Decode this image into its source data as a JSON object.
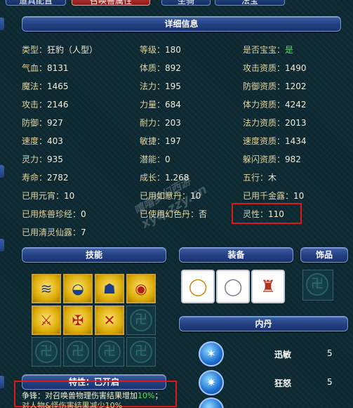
{
  "tabs": [
    "道具配置",
    "召唤兽属性",
    "坐骑",
    "法宝"
  ],
  "detail": {
    "title": "详细信息",
    "col1": [
      {
        "label": "类型：",
        "value": "狂豹（人型）"
      },
      {
        "label": "气血：",
        "value": "8131"
      },
      {
        "label": "魔法：",
        "value": "1465"
      },
      {
        "label": "攻击：",
        "value": "2146"
      },
      {
        "label": "防御：",
        "value": "927"
      },
      {
        "label": "速度：",
        "value": "403"
      },
      {
        "label": "灵力：",
        "value": "935"
      },
      {
        "label": "寿命：",
        "value": "2782"
      },
      {
        "label": "已用元宵：",
        "value": "10"
      },
      {
        "label": "已用炼兽珍经：",
        "value": "0"
      },
      {
        "label": "已用清灵仙露：",
        "value": "7"
      }
    ],
    "col2": [
      {
        "label": "等级：",
        "value": "180"
      },
      {
        "label": "体质：",
        "value": "892"
      },
      {
        "label": "法力：",
        "value": "195"
      },
      {
        "label": "力量：",
        "value": "684"
      },
      {
        "label": "耐力：",
        "value": "203"
      },
      {
        "label": "敏捷：",
        "value": "197"
      },
      {
        "label": "潜能：",
        "value": "0"
      },
      {
        "label": "成长：",
        "value": "1.268"
      },
      {
        "label": "已用如意丹：",
        "value": "10"
      },
      {
        "label": "已使用幻色丹：",
        "value": "否"
      }
    ],
    "col3": [
      {
        "label": "是否宝宝：",
        "value": "是"
      },
      {
        "label": "攻击资质：",
        "value": "1490"
      },
      {
        "label": "防御资质：",
        "value": "1202"
      },
      {
        "label": "体力资质：",
        "value": "4242"
      },
      {
        "label": "法力资质：",
        "value": "2013"
      },
      {
        "label": "速度资质：",
        "value": "1434"
      },
      {
        "label": "躲闪资质：",
        "value": "982"
      },
      {
        "label": "五行：",
        "value": "木"
      },
      {
        "label": "已用千金露：",
        "value": "10"
      },
      {
        "label": "灵性：",
        "value": "110"
      }
    ]
  },
  "sections": {
    "skills": "技能",
    "equipment": "装备",
    "accessory": "饰品",
    "neidan": "内丹",
    "trait": "特性：已开启"
  },
  "neidan": [
    {
      "name": "迅敏",
      "level": "5"
    },
    {
      "name": "狂怒",
      "level": "5"
    }
  ],
  "trait_desc": {
    "line1_prefix": "争锋：对召唤兽物理伤害结果增加",
    "line1_value": "10%",
    "line1_suffix": "；",
    "line2": "对人物&怪伤害结果减少10%"
  },
  "watermark": "xyq.zzy.cn",
  "watermark2": "嘻嘻梦幻西游"
}
